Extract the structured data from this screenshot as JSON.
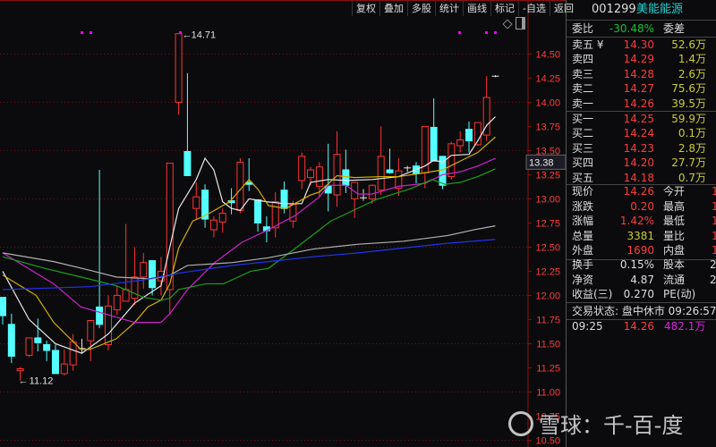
{
  "toolbar": {
    "buttons": [
      "复权",
      "叠加",
      "多股",
      "统计",
      "画线",
      "标记",
      "-自选",
      "返回"
    ]
  },
  "stock": {
    "code": "001299",
    "name": "美能能源"
  },
  "order_book": {
    "weibi_label": "委比",
    "weibi_value": "-30.48%",
    "weicha_label": "委差",
    "asks": [
      {
        "label": "卖五 ¥",
        "price": "14.30",
        "vol": "52.6万"
      },
      {
        "label": "卖四",
        "price": "14.29",
        "vol": "1.4万"
      },
      {
        "label": "卖三",
        "price": "14.28",
        "vol": "2.6万"
      },
      {
        "label": "卖二",
        "price": "14.27",
        "vol": "75.6万"
      },
      {
        "label": "卖一",
        "price": "14.26",
        "vol": "39.5万"
      }
    ],
    "bids": [
      {
        "label": "买一",
        "price": "14.25",
        "vol": "59.9万"
      },
      {
        "label": "买二",
        "price": "14.24",
        "vol": "0.1万"
      },
      {
        "label": "买三",
        "price": "14.23",
        "vol": "2.8万"
      },
      {
        "label": "买四",
        "price": "14.20",
        "vol": "27.7万"
      },
      {
        "label": "买五",
        "price": "14.18",
        "vol": "0.7万"
      }
    ]
  },
  "quote": [
    {
      "l": "现价",
      "v": "14.26",
      "l2": "今开",
      "v2": "1"
    },
    {
      "l": "涨跌",
      "v": "0.20",
      "l2": "最高",
      "v2": "1"
    },
    {
      "l": "涨幅",
      "v": "1.42%",
      "l2": "最低",
      "v2": "1"
    },
    {
      "l": "总量",
      "v": "3381",
      "l2": "量比",
      "v2": "1"
    },
    {
      "l": "外盘",
      "v": "1690",
      "l2": "内盘",
      "v2": "1"
    }
  ],
  "fundamentals": [
    {
      "l": "换手",
      "v": "0.15%",
      "l2": "股本",
      "v2": "2."
    },
    {
      "l": "净资",
      "v": "4.87",
      "l2": "流通",
      "v2": "2."
    },
    {
      "l": "收益(三)",
      "v": "0.270",
      "l2": "PE(动)",
      "v2": ""
    }
  ],
  "status": {
    "text": "交易状态: 盘中休市 09:26:57"
  },
  "tick": {
    "time": "09:25",
    "price": "14.26",
    "vol": "482.1万"
  },
  "watermark": "雪球：千-百-度",
  "colors": {
    "up": "#ff3232",
    "down": "#54ffff",
    "grid": "#7a1010",
    "axis_text": "#ff3b3b"
  },
  "chart_data": {
    "type": "candlestick",
    "ylim": [
      10.43,
      14.92
    ],
    "y_ticks": [
      "14.50",
      "14.25",
      "14.00",
      "13.75",
      "13.50",
      "13.25",
      "13.00",
      "12.75",
      "12.50",
      "12.25",
      "12.00",
      "11.75",
      "11.50",
      "11.25",
      "11.00",
      "10.75",
      "10.50"
    ],
    "crosshair_price": "13.38",
    "annotations": {
      "high": "14.71",
      "low": "11.12"
    },
    "ohlc": [
      [
        11.98,
        11.98,
        11.7,
        11.79
      ],
      [
        11.7,
        11.81,
        11.3,
        11.37
      ],
      [
        11.22,
        11.26,
        11.12,
        11.24
      ],
      [
        11.38,
        11.56,
        11.36,
        11.56
      ],
      [
        11.56,
        11.76,
        11.42,
        11.51
      ],
      [
        11.49,
        11.53,
        11.32,
        11.43
      ],
      [
        11.43,
        11.49,
        11.19,
        11.19
      ],
      [
        11.19,
        11.44,
        11.17,
        11.29
      ],
      [
        11.28,
        11.6,
        11.22,
        11.52
      ],
      [
        11.45,
        11.55,
        11.4,
        11.45
      ],
      [
        11.53,
        11.74,
        11.32,
        11.74
      ],
      [
        11.88,
        13.3,
        11.66,
        11.7
      ],
      [
        11.49,
        12.0,
        11.43,
        11.89
      ],
      [
        11.85,
        12.1,
        11.8,
        12.0
      ],
      [
        11.94,
        12.74,
        11.94,
        12.06
      ],
      [
        11.97,
        12.5,
        11.9,
        12.19
      ],
      [
        12.19,
        12.44,
        12.07,
        12.34
      ],
      [
        12.36,
        12.36,
        12.0,
        12.08
      ],
      [
        12.15,
        12.4,
        12.0,
        12.25
      ],
      [
        12.06,
        13.37,
        11.8,
        13.37
      ],
      [
        14.0,
        14.71,
        13.87,
        14.71
      ],
      [
        13.49,
        14.3,
        13.49,
        13.24
      ],
      [
        12.9,
        13.17,
        12.79,
        13.02
      ],
      [
        13.09,
        13.15,
        12.7,
        12.79
      ],
      [
        12.68,
        12.82,
        12.6,
        12.78
      ],
      [
        12.76,
        12.9,
        12.65,
        12.85
      ],
      [
        12.98,
        13.11,
        12.84,
        12.96
      ],
      [
        12.88,
        13.42,
        12.85,
        13.38
      ],
      [
        13.17,
        13.42,
        13.08,
        13.15
      ],
      [
        12.99,
        12.99,
        12.66,
        12.75
      ],
      [
        12.71,
        12.82,
        12.55,
        12.67
      ],
      [
        12.7,
        13.07,
        12.6,
        12.97
      ],
      [
        13.09,
        13.18,
        12.85,
        12.9
      ],
      [
        12.77,
        12.98,
        12.7,
        12.94
      ],
      [
        13.19,
        13.48,
        13.1,
        13.44
      ],
      [
        13.22,
        13.33,
        13.14,
        13.3
      ],
      [
        13.13,
        13.38,
        13.02,
        13.33
      ],
      [
        13.13,
        13.57,
        12.87,
        13.06
      ],
      [
        13.04,
        13.7,
        12.92,
        13.46
      ],
      [
        13.3,
        13.51,
        13.06,
        13.14
      ],
      [
        13.0,
        13.08,
        12.8,
        13.17
      ],
      [
        13.01,
        13.1,
        12.98,
        13.01
      ],
      [
        13.0,
        13.15,
        12.95,
        13.14
      ],
      [
        13.09,
        13.75,
        13.04,
        13.44
      ],
      [
        13.3,
        13.52,
        13.26,
        13.27
      ],
      [
        13.11,
        13.42,
        13.03,
        13.29
      ],
      [
        13.31,
        13.34,
        13.28,
        13.32
      ],
      [
        13.34,
        13.38,
        13.16,
        13.26
      ],
      [
        13.27,
        13.75,
        13.11,
        13.75
      ],
      [
        13.74,
        14.04,
        13.39,
        13.39
      ],
      [
        13.44,
        13.44,
        13.1,
        13.14
      ],
      [
        13.23,
        13.59,
        13.2,
        13.57
      ],
      [
        13.55,
        13.7,
        13.48,
        13.61
      ],
      [
        13.72,
        13.8,
        13.48,
        13.6
      ],
      [
        13.56,
        13.79,
        13.55,
        13.79
      ],
      [
        13.66,
        14.27,
        13.6,
        14.05
      ],
      [
        14.26,
        14.28,
        14.26,
        14.27
      ]
    ],
    "ma_lines": [
      {
        "name": "MA5",
        "color": "#e8e8e8",
        "pts": [
          [
            0,
            12.25
          ],
          [
            3,
            11.75
          ],
          [
            6,
            11.5
          ],
          [
            9,
            11.4
          ],
          [
            12,
            11.6
          ],
          [
            15,
            11.92
          ],
          [
            18,
            12.1
          ],
          [
            20,
            12.9
          ],
          [
            22,
            13.2
          ],
          [
            23,
            13.42
          ],
          [
            24,
            13.3
          ],
          [
            25,
            12.97
          ],
          [
            26,
            12.9
          ],
          [
            27,
            12.88
          ],
          [
            28,
            13.0
          ],
          [
            30,
            12.97
          ],
          [
            32,
            12.95
          ],
          [
            34,
            12.95
          ],
          [
            35,
            13.17
          ],
          [
            37,
            13.2
          ],
          [
            39,
            13.19
          ],
          [
            42,
            13.2
          ],
          [
            45,
            13.23
          ],
          [
            48,
            13.34
          ],
          [
            49,
            13.4
          ],
          [
            50,
            13.38
          ],
          [
            51,
            13.45
          ],
          [
            53,
            13.46
          ],
          [
            54,
            13.6
          ],
          [
            55,
            13.76
          ],
          [
            56,
            13.85
          ]
        ]
      },
      {
        "name": "MA10",
        "color": "#d4b000",
        "pts": [
          [
            0,
            12.21
          ],
          [
            3.8,
            12.0
          ],
          [
            5.8,
            11.72
          ],
          [
            8.9,
            11.44
          ],
          [
            9.9,
            11.44
          ],
          [
            12.9,
            11.55
          ],
          [
            15,
            11.72
          ],
          [
            16.5,
            11.88
          ],
          [
            18,
            11.95
          ],
          [
            19,
            12.12
          ],
          [
            20,
            12.49
          ],
          [
            21.6,
            12.77
          ],
          [
            23.1,
            12.83
          ],
          [
            25.8,
            12.97
          ],
          [
            28,
            13.2
          ],
          [
            29,
            13.1
          ],
          [
            30.2,
            12.93
          ],
          [
            32.2,
            12.9
          ],
          [
            35,
            13.04
          ],
          [
            36,
            13.07
          ],
          [
            38,
            13.24
          ],
          [
            40,
            13.22
          ],
          [
            43,
            13.23
          ],
          [
            45,
            13.23
          ],
          [
            48,
            13.27
          ],
          [
            50,
            13.3
          ],
          [
            52,
            13.39
          ],
          [
            54,
            13.48
          ],
          [
            56,
            13.64
          ]
        ]
      },
      {
        "name": "MA20",
        "color": "#cc22cc",
        "pts": [
          [
            0,
            12.44
          ],
          [
            5.8,
            12.12
          ],
          [
            8.9,
            11.88
          ],
          [
            15,
            11.72
          ],
          [
            18,
            11.72
          ],
          [
            19,
            11.81
          ],
          [
            21,
            12.06
          ],
          [
            24.1,
            12.34
          ],
          [
            27.2,
            12.55
          ],
          [
            30.2,
            12.68
          ],
          [
            33.3,
            12.83
          ],
          [
            36,
            13.02
          ],
          [
            37,
            13.14
          ],
          [
            39,
            13.14
          ],
          [
            40.4,
            13.05
          ],
          [
            42,
            13.05
          ],
          [
            45,
            13.13
          ],
          [
            48,
            13.16
          ],
          [
            50,
            13.25
          ],
          [
            52,
            13.28
          ],
          [
            54,
            13.34
          ],
          [
            56,
            13.42
          ]
        ]
      },
      {
        "name": "MA30",
        "color": "#1aa01a",
        "pts": [
          [
            0,
            12.4
          ],
          [
            4.8,
            12.28
          ],
          [
            8.9,
            12.19
          ],
          [
            12.9,
            12.1
          ],
          [
            16,
            11.98
          ],
          [
            18,
            11.95
          ],
          [
            19,
            11.97
          ],
          [
            20,
            12.06
          ],
          [
            23.1,
            12.12
          ],
          [
            25.1,
            12.12
          ],
          [
            28.2,
            12.25
          ],
          [
            30.2,
            12.28
          ],
          [
            33.3,
            12.49
          ],
          [
            37.3,
            12.77
          ],
          [
            42.4,
            12.99
          ],
          [
            46.5,
            13.11
          ],
          [
            48.8,
            13.2
          ],
          [
            50.3,
            13.15
          ],
          [
            52,
            13.17
          ],
          [
            54,
            13.23
          ],
          [
            56,
            13.31
          ]
        ]
      },
      {
        "name": "MA60",
        "color": "#b0b0b0",
        "pts": [
          [
            0,
            12.44
          ],
          [
            5.8,
            12.35
          ],
          [
            9.9,
            12.26
          ],
          [
            12.9,
            12.19
          ],
          [
            17,
            12.17
          ],
          [
            19,
            12.21
          ],
          [
            21,
            12.31
          ],
          [
            26.1,
            12.34
          ],
          [
            30.2,
            12.39
          ],
          [
            35.3,
            12.48
          ],
          [
            40.4,
            12.53
          ],
          [
            45.5,
            12.56
          ],
          [
            50.6,
            12.62
          ],
          [
            53.6,
            12.68
          ],
          [
            56,
            12.72
          ]
        ]
      },
      {
        "name": "MA120",
        "color": "#2233ee",
        "pts": [
          [
            0,
            12.06
          ],
          [
            9.9,
            12.09
          ],
          [
            16,
            12.16
          ],
          [
            20,
            12.23
          ],
          [
            26.1,
            12.31
          ],
          [
            30.2,
            12.35
          ],
          [
            35.3,
            12.4
          ],
          [
            40.4,
            12.44
          ],
          [
            45.5,
            12.49
          ],
          [
            50.6,
            12.54
          ],
          [
            56,
            12.58
          ]
        ]
      }
    ]
  }
}
